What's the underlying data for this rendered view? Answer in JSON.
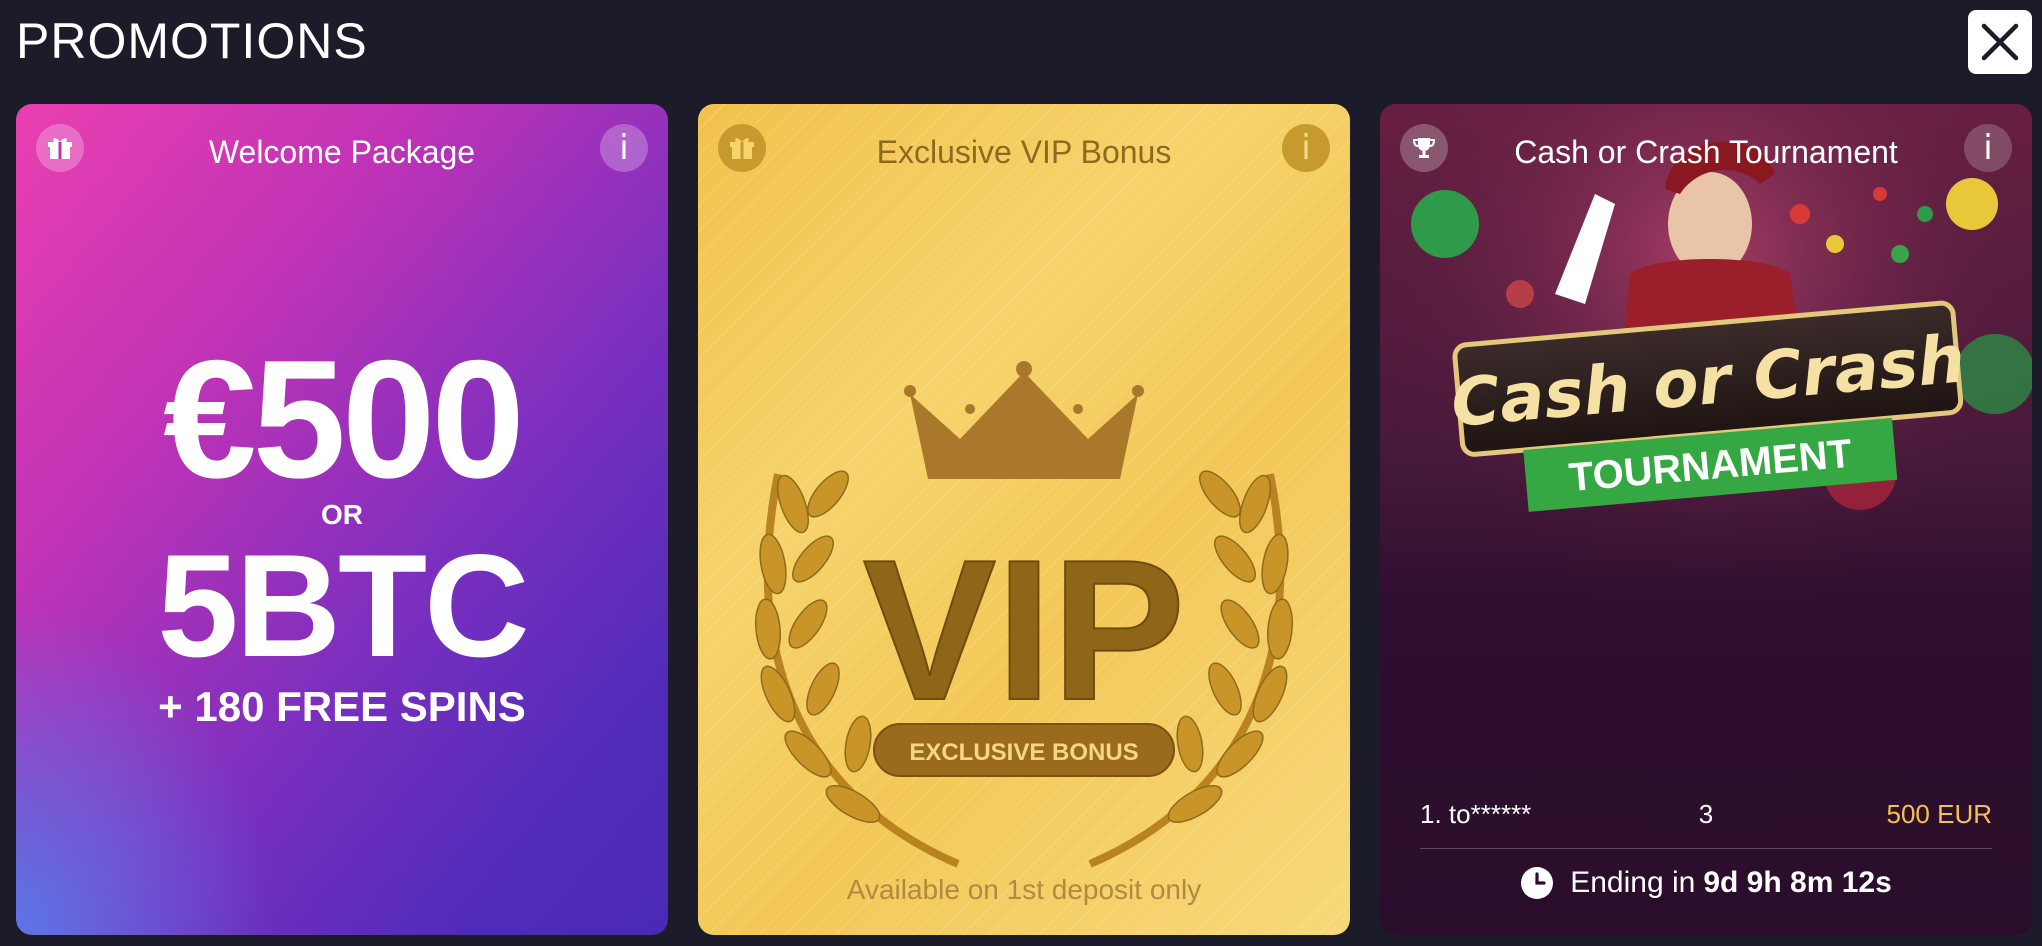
{
  "header": {
    "title": "PROMOTIONS",
    "close_icon": "close-icon"
  },
  "cards": [
    {
      "icon": "gift-icon",
      "title": "Welcome Package",
      "info_label": "i",
      "amount": "€500",
      "or_label": "OR",
      "alt_amount": "5BTC",
      "spins": "+ 180 FREE SPINS"
    },
    {
      "icon": "gift-icon",
      "title": "Exclusive VIP Bonus",
      "info_label": "i",
      "vip_text": "VIP",
      "badge_text": "EXCLUSIVE BONUS",
      "footer": "Available on 1st deposit only"
    },
    {
      "icon": "trophy-icon",
      "title": "Cash or Crash Tournament",
      "info_label": "i",
      "logo_line1": "Cash or Crash",
      "logo_line2": "TOURNAMENT",
      "leaderboard": [
        {
          "rank": "1. to******",
          "score": "3",
          "prize": "500 EUR"
        }
      ],
      "ending_label": "Ending in",
      "ending_time": "9d 9h 8m 12s"
    }
  ],
  "colors": {
    "background": "#1c1b29",
    "vip_gold": "#f3c858",
    "prize_gold": "#f6c14d",
    "welcome_pink": "#ea3fb1",
    "welcome_purple": "#4f2bb9"
  }
}
